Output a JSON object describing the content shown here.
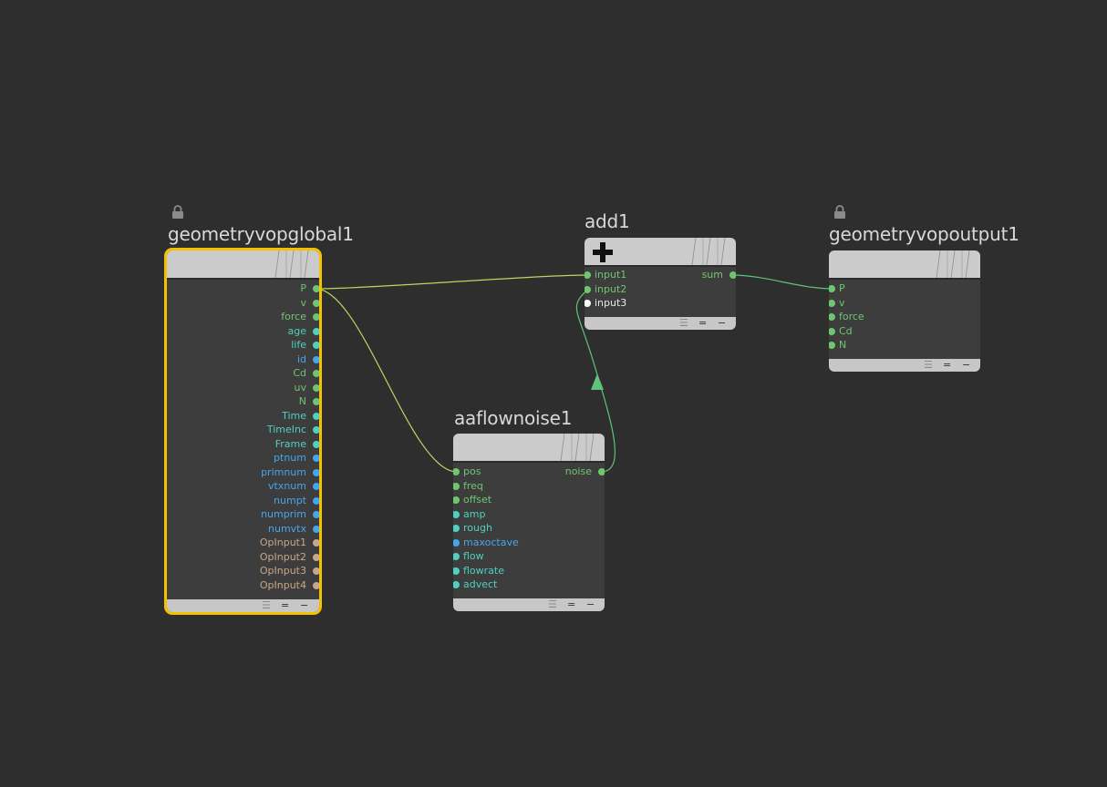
{
  "colors": {
    "background": "#2e2e2e",
    "wire": "#b8d860",
    "wire_green": "#5ec47a",
    "green": "#6ec76e",
    "blue": "#46a6ea",
    "cyan": "#4fd0c0",
    "tan": "#c8a888",
    "white": "#ffffff",
    "selected": "#f2c200"
  },
  "footer_icons": {
    "menu": "☰",
    "equals": "=",
    "dash": "−"
  },
  "nodes": {
    "global": {
      "title": "geometryvopglobal1",
      "locked": true,
      "selected": true,
      "outputs": [
        {
          "label": "P",
          "type": "green"
        },
        {
          "label": "v",
          "type": "green"
        },
        {
          "label": "force",
          "type": "green"
        },
        {
          "label": "age",
          "type": "cyan"
        },
        {
          "label": "life",
          "type": "cyan"
        },
        {
          "label": "id",
          "type": "blue"
        },
        {
          "label": "Cd",
          "type": "green"
        },
        {
          "label": "uv",
          "type": "green"
        },
        {
          "label": "N",
          "type": "green"
        },
        {
          "label": "Time",
          "type": "cyan"
        },
        {
          "label": "TimeInc",
          "type": "cyan"
        },
        {
          "label": "Frame",
          "type": "cyan"
        },
        {
          "label": "ptnum",
          "type": "blue"
        },
        {
          "label": "primnum",
          "type": "blue"
        },
        {
          "label": "vtxnum",
          "type": "blue"
        },
        {
          "label": "numpt",
          "type": "blue"
        },
        {
          "label": "numprim",
          "type": "blue"
        },
        {
          "label": "numvtx",
          "type": "blue"
        },
        {
          "label": "OpInput1",
          "type": "tan"
        },
        {
          "label": "OpInput2",
          "type": "tan"
        },
        {
          "label": "OpInput3",
          "type": "tan"
        },
        {
          "label": "OpInput4",
          "type": "tan"
        }
      ]
    },
    "add": {
      "title": "add1",
      "inputs": [
        {
          "label": "input1",
          "type": "green"
        },
        {
          "label": "input2",
          "type": "green"
        },
        {
          "label": "input3",
          "type": "white"
        }
      ],
      "outputs": [
        {
          "label": "sum",
          "type": "green"
        }
      ]
    },
    "output": {
      "title": "geometryvopoutput1",
      "locked": true,
      "inputs": [
        {
          "label": "P",
          "type": "green"
        },
        {
          "label": "v",
          "type": "green"
        },
        {
          "label": "force",
          "type": "green"
        },
        {
          "label": "Cd",
          "type": "green"
        },
        {
          "label": "N",
          "type": "green"
        }
      ]
    },
    "noise": {
      "title": "aaflownoise1",
      "inputs": [
        {
          "label": "pos",
          "type": "green",
          "pill": false
        },
        {
          "label": "freq",
          "type": "green",
          "pill": true
        },
        {
          "label": "offset",
          "type": "green",
          "pill": true
        },
        {
          "label": "amp",
          "type": "cyan",
          "pill": true
        },
        {
          "label": "rough",
          "type": "cyan",
          "pill": true
        },
        {
          "label": "maxoctave",
          "type": "blue",
          "pill": false
        },
        {
          "label": "flow",
          "type": "cyan",
          "pill": true
        },
        {
          "label": "flowrate",
          "type": "cyan",
          "pill": true
        },
        {
          "label": "advect",
          "type": "cyan",
          "pill": false
        }
      ],
      "outputs": [
        {
          "label": "noise",
          "type": "green"
        }
      ]
    }
  },
  "connections": [
    {
      "from": "global.P",
      "to": "add.input1"
    },
    {
      "from": "global.P",
      "to": "noise.pos"
    },
    {
      "from": "noise.noise",
      "to": "add.input2"
    },
    {
      "from": "add.sum",
      "to": "output.P"
    }
  ]
}
